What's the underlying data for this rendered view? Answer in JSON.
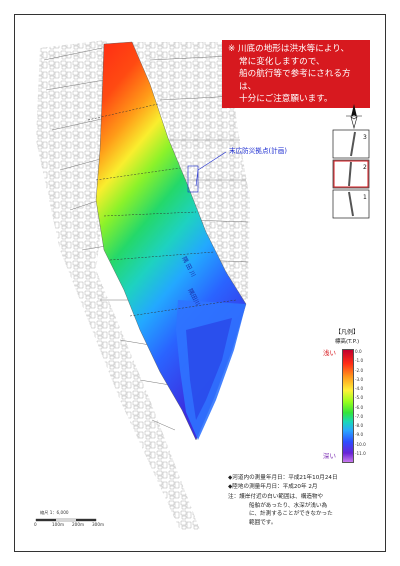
{
  "notice": {
    "line1": "※ 川底の地形は洪水等により、",
    "line2": "常に変化しますので、",
    "line3": "船の航行等で参考にされる方は、",
    "line4": "十分にご注意願います。",
    "bg_color": "#d7191f"
  },
  "callout": {
    "label": "末広防災拠点(計画)"
  },
  "keymap": {
    "sections": [
      "3",
      "2",
      "1"
    ]
  },
  "legend": {
    "title": "【凡例】",
    "unit": "標高(T.P.)",
    "shallow": "浅い",
    "deep": "深い",
    "ticks": [
      "0.0",
      "-1.0",
      "-2.0",
      "-3.0",
      "-4.0",
      "-5.0",
      "-6.0",
      "-7.0",
      "-8.0",
      "-9.0",
      "-10.0",
      "-11.0"
    ]
  },
  "survey": {
    "river": "◆河道内の測量年月日：平成21年10月24日",
    "land": "◆陸地の測量年月日：平成20年 2月"
  },
  "note": {
    "line1": "注：護岸付近の白い範囲は、構造物や",
    "line2": "船舶があったり、水深が浅い為",
    "line3": "に、計測することができなかった",
    "line4": "範囲です。"
  },
  "scale": {
    "label": "縮尺 1：6,000",
    "marks": [
      "0",
      "100m",
      "200m",
      "300m"
    ]
  },
  "icons": {
    "north": "north-arrow-icon",
    "key": "index-map-icon"
  }
}
